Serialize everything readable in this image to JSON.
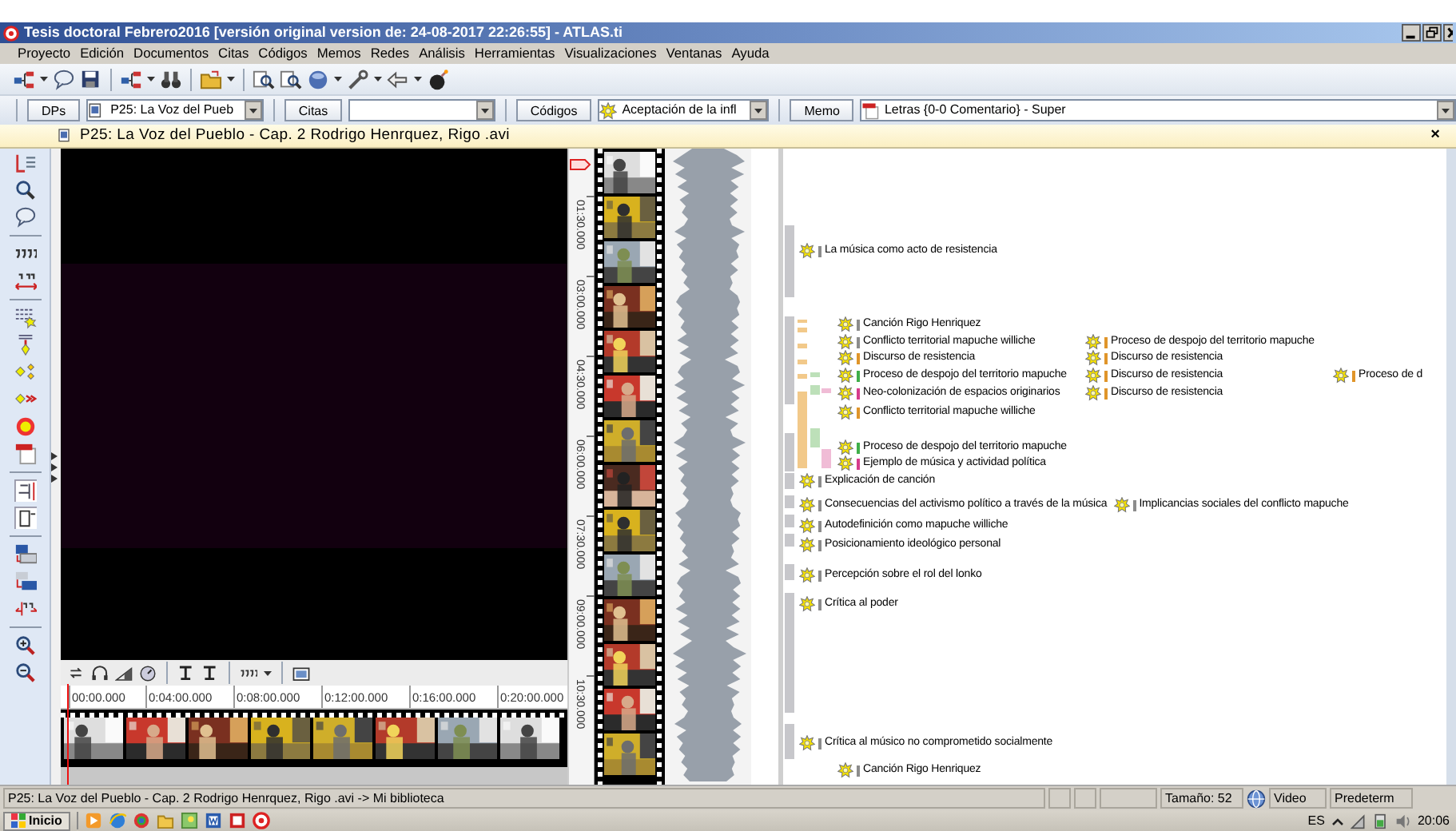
{
  "window": {
    "title": "Tesis doctoral Febrero2016 [versión original version de: 24-08-2017 22:26:55] - ATLAS.ti"
  },
  "menu": [
    "Proyecto",
    "Edición",
    "Documentos",
    "Citas",
    "Códigos",
    "Memos",
    "Redes",
    "Análisis",
    "Herramientas",
    "Visualizaciones",
    "Ventanas",
    "Ayuda"
  ],
  "selectors": [
    {
      "kind": "document",
      "button": "DPs",
      "value": "P25: La Voz del Pueb"
    },
    {
      "kind": "quotation",
      "button": "Citas"
    },
    {
      "kind": "code",
      "button": "Códigos",
      "value": "Aceptación de la infl"
    },
    {
      "kind": "memo",
      "button": "Memo",
      "value": "Letras {0-0 Comentario} - Super"
    }
  ],
  "document": {
    "title": "P25:  La Voz del Pueblo - Cap. 2 Rodrigo Henrquez,  Rigo .avi",
    "close": "×"
  },
  "timeline": {
    "vertical": [
      "01:30.000",
      "03:00.000",
      "04:30.000",
      "06:00.000",
      "07:30.000",
      "09:00.000",
      "10:30.000"
    ],
    "horizontal": [
      "00:00.000",
      "0:04:00.000",
      "0:08:00.000",
      "0:12:00.000",
      "0:16:00.000",
      "0:20:00.000"
    ]
  },
  "margin": [
    {
      "kind": "plain",
      "codes": [
        {
          "label": "La música como acto de resistencia",
          "color": "#8c8c8c"
        }
      ]
    },
    {
      "kind": "indented",
      "codes": [
        {
          "label": "Canción Rigo Henriquez",
          "color": "#8c8c8c"
        }
      ]
    },
    {
      "kind": "indented",
      "codes": [
        {
          "label": "Conflicto territorial mapuche williche",
          "color": "#8c8c8c"
        },
        {
          "label": "Proceso de despojo del territorio mapuche",
          "color": "#e0952a"
        }
      ]
    },
    {
      "kind": "indented",
      "codes": [
        {
          "label": "Discurso de resistencia",
          "color": "#e0952a"
        },
        {
          "label": "Discurso de resistencia",
          "color": "#e0952a"
        }
      ]
    },
    {
      "kind": "indented",
      "codes": [
        {
          "label": "Proceso de despojo del territorio mapuche",
          "color": "#3fae49"
        },
        {
          "label": "Discurso de resistencia",
          "color": "#e0952a"
        },
        {
          "label": "Proceso de d",
          "color": "#e0952a"
        }
      ]
    },
    {
      "kind": "indented",
      "codes": [
        {
          "label": "Neo-colonización de espacios originarios",
          "color": "#d63c8c"
        },
        {
          "label": "Discurso de resistencia",
          "color": "#e0952a"
        }
      ]
    },
    {
      "kind": "indented",
      "codes": [
        {
          "label": "Conflicto territorial mapuche williche",
          "color": "#e0952a"
        }
      ]
    },
    {
      "kind": "indented",
      "codes": [
        {
          "label": "Proceso de despojo del territorio mapuche",
          "color": "#3fae49"
        }
      ]
    },
    {
      "kind": "indented",
      "codes": [
        {
          "label": "Ejemplo de música y actividad política",
          "color": "#d63c8c"
        }
      ]
    },
    {
      "kind": "plain",
      "codes": [
        {
          "label": "Explicación de canción",
          "color": "#8c8c8c"
        }
      ]
    },
    {
      "kind": "plain",
      "codes": [
        {
          "label": "Consecuencias del activismo político a través de la música",
          "color": "#8c8c8c"
        },
        {
          "label": "Implicancias sociales del conflicto mapuche",
          "color": "#8c8c8c"
        }
      ]
    },
    {
      "kind": "plain",
      "codes": [
        {
          "label": "Autodefinición como mapuche williche",
          "color": "#8c8c8c"
        }
      ]
    },
    {
      "kind": "plain",
      "codes": [
        {
          "label": "Posicionamiento ideológico personal",
          "color": "#8c8c8c"
        }
      ]
    },
    {
      "kind": "plain",
      "codes": [
        {
          "label": "Percepción sobre el rol del lonko",
          "color": "#8c8c8c"
        }
      ]
    },
    {
      "kind": "plain",
      "codes": [
        {
          "label": "Crítica al poder",
          "color": "#8c8c8c"
        }
      ]
    },
    {
      "kind": "plain",
      "codes": [
        {
          "label": "Crítica al músico no comprometido socialmente",
          "color": "#8c8c8c"
        }
      ]
    },
    {
      "kind": "indented",
      "codes": [
        {
          "label": "Canción Rigo Henriquez",
          "color": "#8c8c8c"
        }
      ]
    }
  ],
  "status_bar": {
    "path": "P25: La Voz del Pueblo - Cap. 2 Rodrigo Henrquez,  Rigo .avi -> Mi biblioteca",
    "size": "Tamaño: 52",
    "media": "Video",
    "setting": "Predeterm"
  },
  "taskbar": {
    "start": "Inicio",
    "language": "ES",
    "clock": "20:06"
  }
}
